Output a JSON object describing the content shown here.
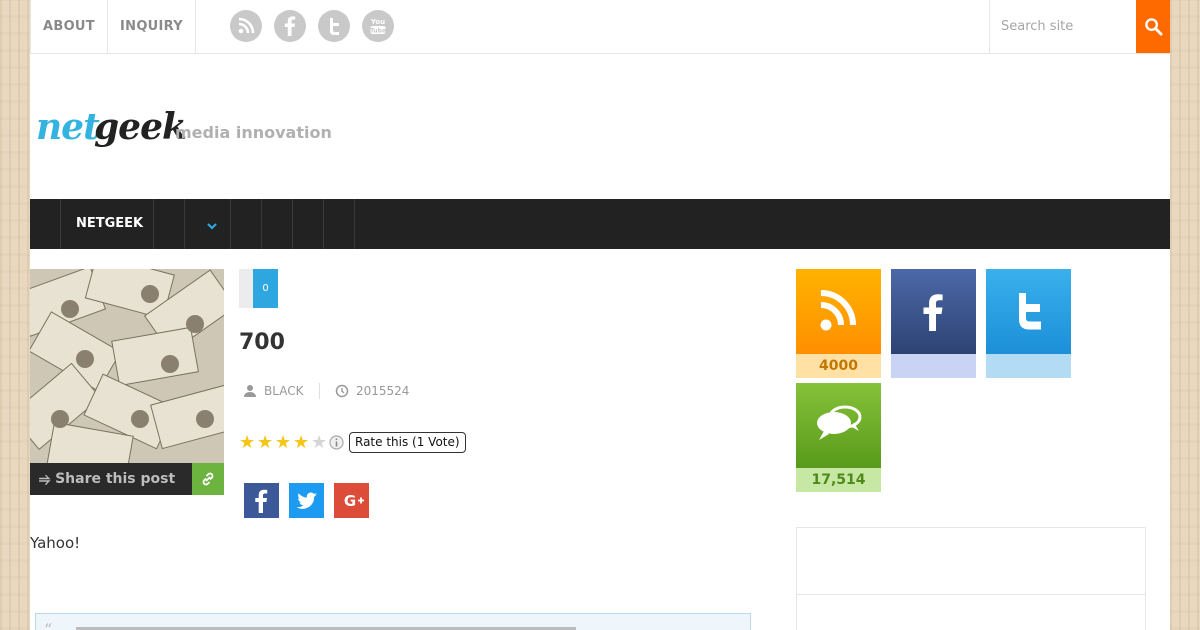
{
  "topbar": {
    "links": [
      "ABOUT",
      "INQUIRY"
    ],
    "social_icons": [
      "rss-icon",
      "facebook-icon",
      "twitter-icon",
      "youtube-icon"
    ],
    "search_placeholder": "Search site"
  },
  "logo": {
    "part1": "net",
    "part2": "geek",
    "tagline": "media innovation"
  },
  "nav": {
    "items": [
      "NETGEEK"
    ]
  },
  "post": {
    "share_label": "Share this post",
    "comment_count": "0",
    "title": "700",
    "author": "BLACK",
    "date": "2015524",
    "rating_stars": 4,
    "rating_max": 5,
    "rating_label": "Rate this (1 Vote)",
    "body": "Yahoo!"
  },
  "sidebar": {
    "tiles": [
      {
        "name": "rss",
        "count": "4000",
        "color": "#ff9900"
      },
      {
        "name": "facebook",
        "count": "",
        "color": "#3b5998"
      },
      {
        "name": "twitter",
        "count": "",
        "color": "#1da1f2"
      },
      {
        "name": "comments",
        "count": "17,514",
        "color": "#6bb12a"
      }
    ]
  },
  "colors": {
    "accent_orange": "#ff6a00",
    "accent_blue": "#2ea7e0",
    "nav_bg": "#222222"
  }
}
